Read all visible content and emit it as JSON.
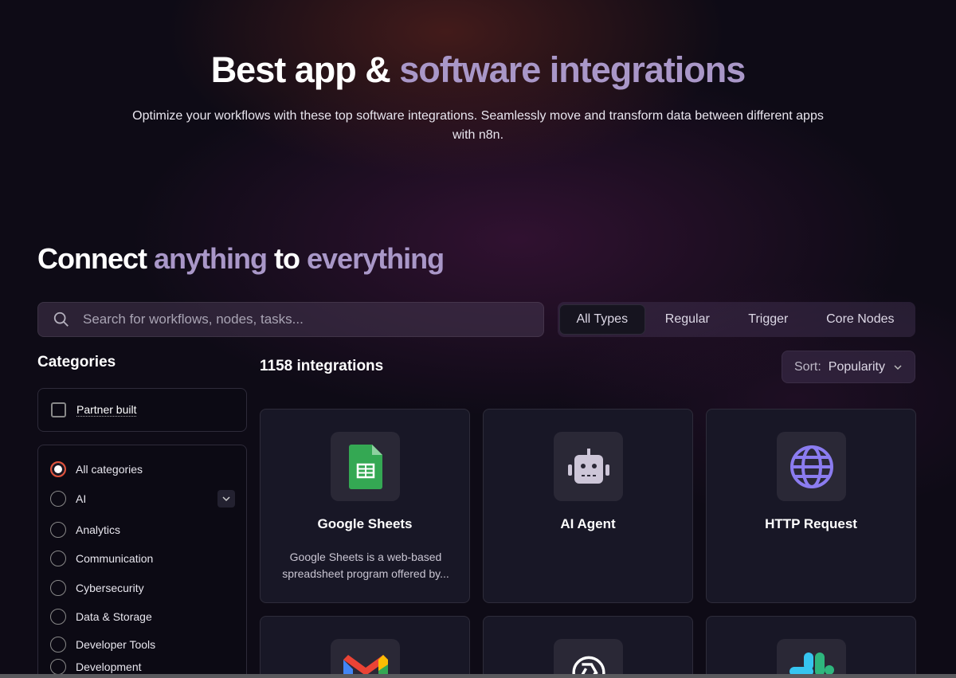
{
  "hero": {
    "title_a": "Best app & ",
    "title_b": "software integrations",
    "subtitle": "Optimize your workflows with these top software integrations. Seamlessly move and transform data between different apps with n8n."
  },
  "section": {
    "title_a": "Connect ",
    "title_b": "anything ",
    "title_c": "to ",
    "title_d": "everything"
  },
  "search": {
    "placeholder": "Search for workflows, nodes, tasks..."
  },
  "tabs": [
    {
      "label": "All Types",
      "active": true
    },
    {
      "label": "Regular"
    },
    {
      "label": "Trigger"
    },
    {
      "label": "Core Nodes"
    }
  ],
  "categories": {
    "title": "Categories",
    "partner": "Partner built",
    "items": [
      "All categories",
      "AI",
      "Analytics",
      "Communication",
      "Cybersecurity",
      "Data & Storage",
      "Developer Tools",
      "Development"
    ],
    "selected": "All categories"
  },
  "results": {
    "count": "1158 integrations",
    "sort_label": "Sort:",
    "sort_value": "Popularity"
  },
  "cards": [
    {
      "title": "Google Sheets",
      "desc": "Google Sheets is a web-based spreadsheet program offered by...",
      "icon": "google-sheets-icon"
    },
    {
      "title": "AI Agent",
      "desc": "",
      "icon": "robot-icon"
    },
    {
      "title": "HTTP Request",
      "desc": "",
      "icon": "globe-icon"
    },
    {
      "title": "",
      "icon": "gmail-icon"
    },
    {
      "title": "",
      "icon": "openai-icon"
    },
    {
      "title": "",
      "icon": "slack-icon"
    }
  ],
  "colors": {
    "accent": "#a997c8",
    "radio_selected": "#e0503a",
    "globe": "#8b7cf0",
    "sheets": "#34a853"
  }
}
